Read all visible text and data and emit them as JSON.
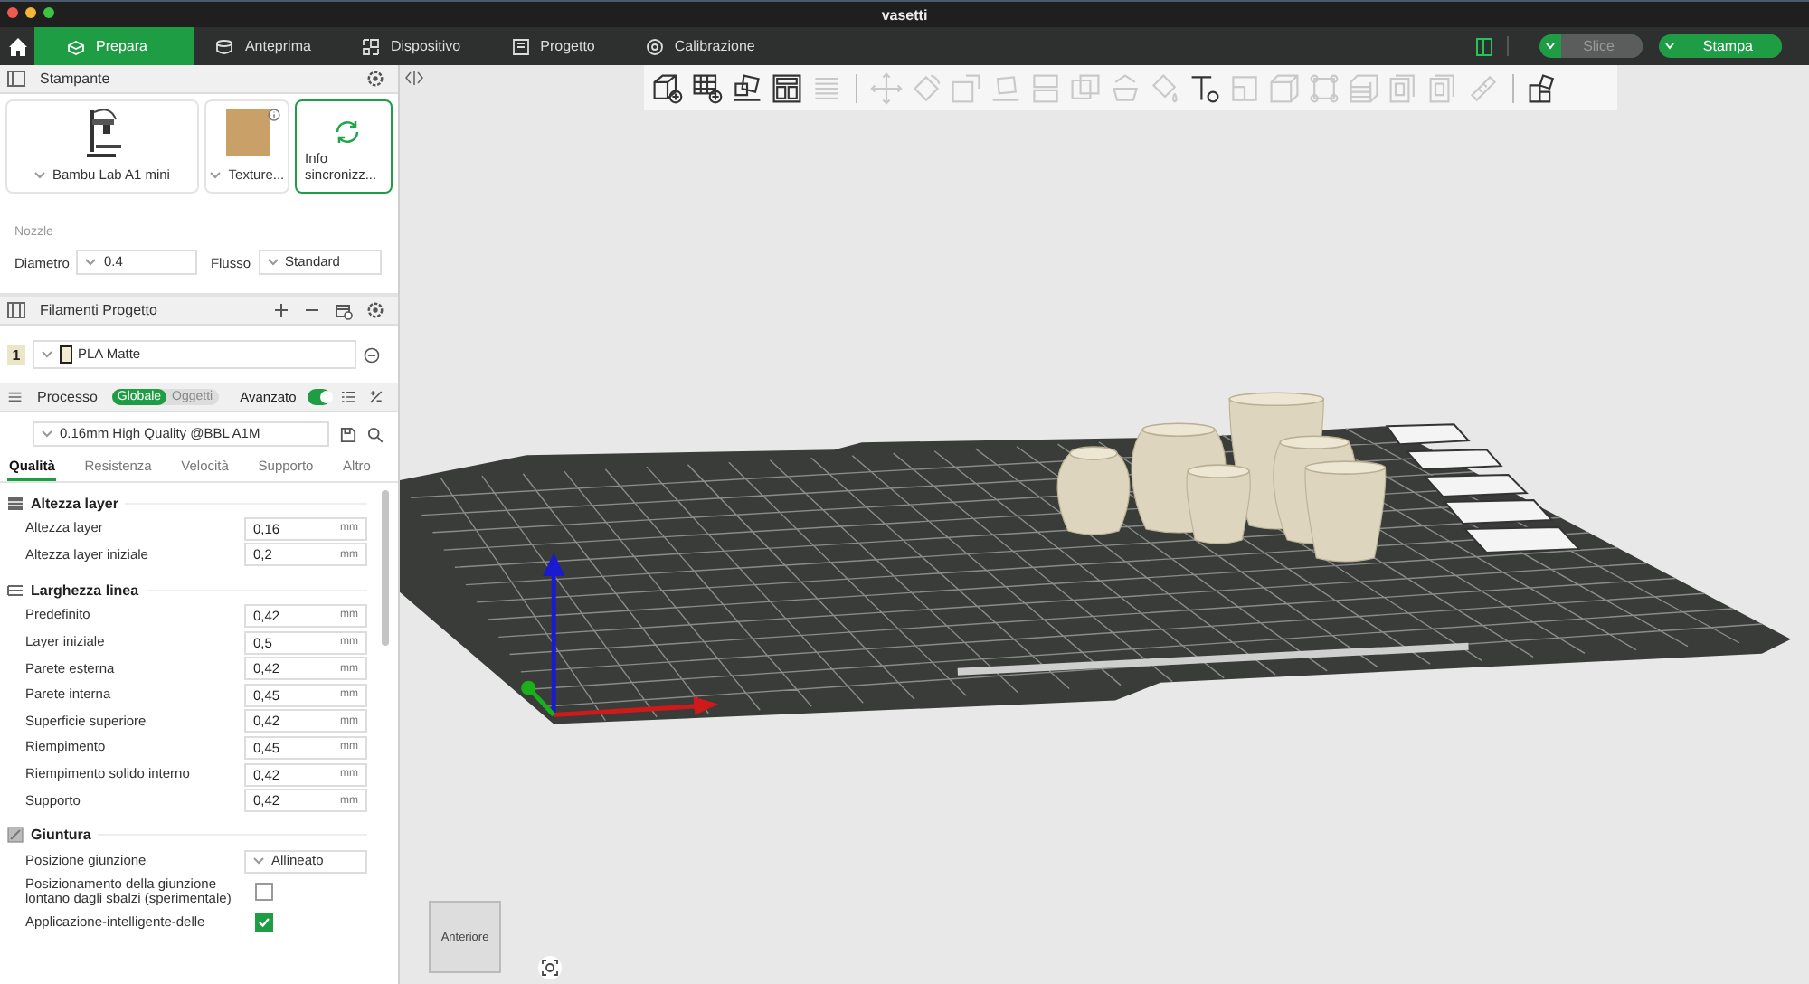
{
  "window": {
    "title": "vasetti"
  },
  "nav": {
    "tabs": [
      {
        "label": "Prepara",
        "kind": "prepare",
        "selected": true
      },
      {
        "label": "Anteprima",
        "kind": "preview",
        "selected": false
      },
      {
        "label": "Dispositivo",
        "kind": "device",
        "selected": false
      },
      {
        "label": "Progetto",
        "kind": "project",
        "selected": false
      },
      {
        "label": "Calibrazione",
        "kind": "calibration",
        "selected": false
      }
    ],
    "slice_button": {
      "label": "Slice",
      "disabled": true
    },
    "print_button": {
      "label": "Stampa",
      "disabled": false
    }
  },
  "printer": {
    "title": "Stampante",
    "cards": [
      {
        "kind": "printer",
        "label": "Bambu Lab A1 mini",
        "selected": false
      },
      {
        "kind": "plate",
        "label": "Texture...",
        "selected": false
      },
      {
        "kind": "sync",
        "label": "Info sincronizz...",
        "selected": true
      }
    ],
    "nozzle_label": "Nozzle",
    "fields": [
      {
        "label": "Diametro",
        "value": "0.4"
      },
      {
        "label": "Flusso",
        "value": "Standard"
      }
    ]
  },
  "filaments": {
    "title": "Filamenti Progetto",
    "items": [
      {
        "index": "1",
        "name": "PLA Matte",
        "color": "#f2ecd2"
      }
    ]
  },
  "process": {
    "title": "Processo",
    "scope": [
      {
        "label": "Globale",
        "selected": true
      },
      {
        "label": "Oggetti",
        "selected": false
      }
    ],
    "advanced": {
      "label": "Avanzato",
      "on": true
    },
    "preset": "0.16mm High Quality @BBL A1M",
    "tabs": [
      {
        "label": "Qualità",
        "selected": true
      },
      {
        "label": "Resistenza",
        "selected": false
      },
      {
        "label": "Velocità",
        "selected": false
      },
      {
        "label": "Supporto",
        "selected": false
      },
      {
        "label": "Altro",
        "selected": false
      }
    ],
    "groups": [
      {
        "kind": "layer",
        "title": "Altezza layer",
        "rows": [
          {
            "kind": "number",
            "label": "Altezza layer",
            "value": "0,16",
            "unit": "mm"
          },
          {
            "kind": "number",
            "label": "Altezza layer iniziale",
            "value": "0,2",
            "unit": "mm"
          }
        ]
      },
      {
        "kind": "line",
        "title": "Larghezza linea",
        "rows": [
          {
            "kind": "number",
            "label": "Predefinito",
            "value": "0,42",
            "unit": "mm"
          },
          {
            "kind": "number",
            "label": "Layer iniziale",
            "value": "0,5",
            "unit": "mm"
          },
          {
            "kind": "number",
            "label": "Parete esterna",
            "value": "0,42",
            "unit": "mm"
          },
          {
            "kind": "number",
            "label": "Parete interna",
            "value": "0,45",
            "unit": "mm"
          },
          {
            "kind": "number",
            "label": "Superficie superiore",
            "value": "0,42",
            "unit": "mm"
          },
          {
            "kind": "number",
            "label": "Riempimento",
            "value": "0,45",
            "unit": "mm"
          },
          {
            "kind": "number",
            "label": "Riempimento solido interno",
            "value": "0,42",
            "unit": "mm"
          },
          {
            "kind": "number",
            "label": "Supporto",
            "value": "0,42",
            "unit": "mm"
          }
        ]
      },
      {
        "kind": "seam",
        "title": "Giuntura",
        "rows": [
          {
            "kind": "select",
            "label": "Posizione giunzione",
            "value": "Allineato"
          },
          {
            "kind": "checkbox",
            "label": "Posizionamento della giunzione lontano dagli sbalzi (sperimentale)",
            "checked": false
          },
          {
            "kind": "checkbox",
            "label": "Applicazione-intelligente-delle",
            "checked": true
          }
        ]
      }
    ]
  },
  "toolbar": [
    {
      "kind": "cube",
      "disabled": false
    },
    {
      "kind": "grid",
      "disabled": false
    },
    {
      "kind": "arrange",
      "disabled": false
    },
    {
      "kind": "layout",
      "disabled": false
    },
    {
      "kind": "lines",
      "disabled": true
    },
    {
      "kind": "separator"
    },
    {
      "kind": "move",
      "disabled": true
    },
    {
      "kind": "rotate",
      "disabled": true
    },
    {
      "kind": "scale",
      "disabled": true
    },
    {
      "kind": "flat",
      "disabled": true
    },
    {
      "kind": "split",
      "disabled": true
    },
    {
      "kind": "overlap",
      "disabled": true
    },
    {
      "kind": "support",
      "disabled": true
    },
    {
      "kind": "paint",
      "disabled": true
    },
    {
      "kind": "text",
      "disabled": false
    },
    {
      "kind": "half",
      "disabled": true
    },
    {
      "kind": "box",
      "disabled": true
    },
    {
      "kind": "corners",
      "disabled": true
    },
    {
      "kind": "stack",
      "disabled": true
    },
    {
      "kind": "page",
      "disabled": true
    },
    {
      "kind": "page",
      "disabled": true
    },
    {
      "kind": "ruler",
      "disabled": true
    },
    {
      "kind": "separator"
    },
    {
      "kind": "puzzle",
      "disabled": false
    }
  ],
  "viewport": {
    "view_cube": {
      "label": "Anteriore"
    }
  }
}
